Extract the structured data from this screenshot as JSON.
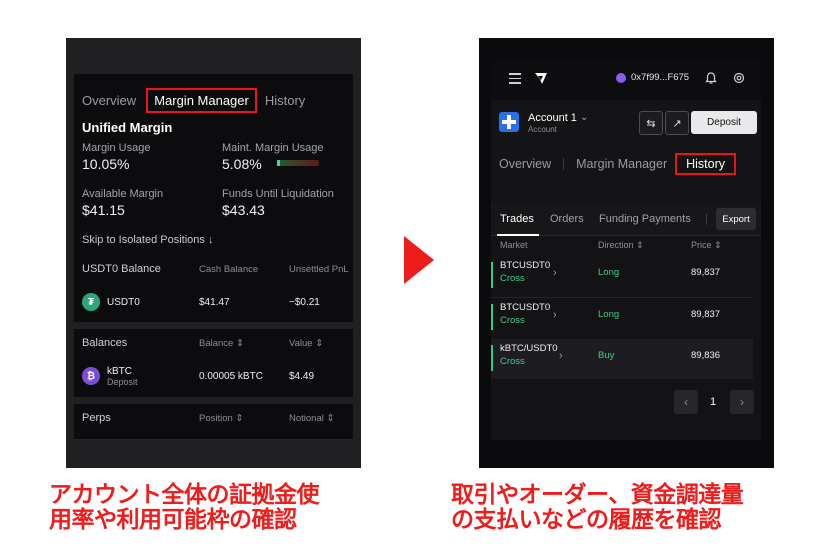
{
  "left": {
    "tabs": [
      "Overview",
      "Margin Manager",
      "History"
    ],
    "active_tab": "Margin Manager",
    "unified_margin_title": "Unified Margin",
    "margin_usage_label": "Margin Usage",
    "margin_usage_value": "10.05%",
    "maint_margin_label": "Maint. Margin Usage",
    "maint_margin_value": "5.08%",
    "available_margin_label": "Available Margin",
    "available_margin_value": "$41.15",
    "funds_until_liq_label": "Funds Until Liquidation",
    "funds_until_liq_value": "$43.43",
    "skip_link": "Skip to Isolated Positions ↓",
    "usdt0_section": {
      "title": "USDT0 Balance",
      "col_cash": "Cash Balance",
      "col_unsettled": "Unsettled PnL",
      "token": "USDT0",
      "cash": "$41.47",
      "unsettled": "−$0.21"
    },
    "balances_section": {
      "title": "Balances",
      "col_balance": "Balance ⇕",
      "col_value": "Value ⇕",
      "token": "kBTC",
      "token_sub": "Deposit",
      "balance": "0.00005 kBTC",
      "value": "$4.49"
    },
    "perps_section": {
      "title": "Perps",
      "col_position": "Position ⇕",
      "col_notional": "Notional ⇕"
    }
  },
  "right": {
    "wallet": "0x7f99...F675",
    "account_name": "Account 1",
    "account_sub": "Account",
    "deposit_label": "Deposit",
    "tabs": [
      "Overview",
      "Margin Manager",
      "History"
    ],
    "active_tab": "History",
    "subtabs": [
      "Trades",
      "Orders",
      "Funding Payments"
    ],
    "active_subtab": "Trades",
    "export_label": "Export",
    "columns": [
      "Market",
      "Direction ⇕",
      "Price ⇕"
    ],
    "rows": [
      {
        "market": "BTCUSDT0",
        "type": "Cross",
        "direction": "Long",
        "price": "89,837"
      },
      {
        "market": "BTCUSDT0",
        "type": "Cross",
        "direction": "Long",
        "price": "89,837"
      },
      {
        "market": "kBTC/USDT0",
        "type": "Cross",
        "direction": "Buy",
        "price": "89,836"
      }
    ],
    "page": "1"
  },
  "captions": {
    "left_line1": "アカウント全体の証拠金使",
    "left_line2": "用率や利用可能枠の確認",
    "right_line1": "取引やオーダー、資金調達量",
    "right_line2": "の支払いなどの履歴を確認"
  },
  "colors": {
    "highlight_red": "#e8151d",
    "caption_red": "#ef1c1c",
    "positive_green": "#3ccf80"
  }
}
